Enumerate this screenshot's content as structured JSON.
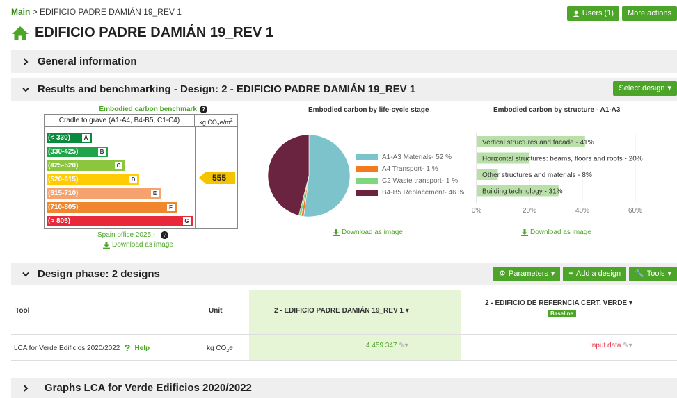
{
  "breadcrumb": {
    "main": "Main",
    "sep": " > ",
    "current": "EDIFICIO PADRE DAMIÁN 19_REV 1"
  },
  "top_actions": {
    "users": "Users (1)",
    "more": "More actions"
  },
  "page_title": "EDIFICIO PADRE DAMIÁN 19_REV 1",
  "sections": {
    "general": "General information",
    "results": "Results and benchmarking - Design: 2 - EDIFICIO PADRE DAMIÁN 19_REV 1",
    "select_design": "Select design",
    "design_phase": "Design phase: 2 designs",
    "graphs": "Graphs LCA for Verde Edificios 2020/2022"
  },
  "benchmark": {
    "title": "Embodied carbon benchmark",
    "col1": "Cradle to grave (A1-A4, B4-B5, C1-C4)",
    "col2_unit": "kg CO",
    "col2_sub": "2",
    "col2_rest": "e/m",
    "col2_sup": "2",
    "score": "555",
    "office": "Spain office 2025 -",
    "download": "Download as image",
    "rows": [
      {
        "range": "(< 330)",
        "letter": "A",
        "color": "#0a8a3c",
        "fill": 0.31
      },
      {
        "range": "(330-425)",
        "letter": "B",
        "color": "#1fa44a",
        "fill": 0.42
      },
      {
        "range": "(425-520)",
        "letter": "C",
        "color": "#8cc63f",
        "fill": 0.535
      },
      {
        "range": "(520-615)",
        "letter": "D",
        "color": "#ffcb05",
        "fill": 0.635
      },
      {
        "range": "(615-710)",
        "letter": "E",
        "color": "#f5a26e",
        "fill": 0.78
      },
      {
        "range": "(710-805)",
        "letter": "F",
        "color": "#f0862e",
        "fill": 0.89
      },
      {
        "range": "(> 805)",
        "letter": "G",
        "color": "#e8293a",
        "fill": 1.0
      }
    ]
  },
  "chart_data": [
    {
      "type": "pie",
      "title": "Embodied carbon by life-cycle stage",
      "slices": [
        {
          "label": "A1-A3 Materials- 52 %",
          "value": 52,
          "color": "#7dc3cc"
        },
        {
          "label": "A4 Transport- 1 %",
          "value": 1,
          "color": "#f47a1f"
        },
        {
          "label": "C2 Waste transport- 1 %",
          "value": 1,
          "color": "#7fd67f"
        },
        {
          "label": "B4-B5 Replacement- 46 %",
          "value": 46,
          "color": "#6b2440"
        }
      ],
      "download": "Download as image"
    },
    {
      "type": "bar",
      "orientation": "horizontal",
      "title": "Embodied carbon by structure - A1-A3",
      "categories": [
        "Vertical structures and facade",
        "Horizontal structures: beams, floors and roofs",
        "Other structures and materials",
        "Building technology"
      ],
      "labels": [
        "Vertical structures and facade - 41%",
        "Horizontal structures: beams, floors and roofs - 20%",
        "Other structures and materials - 8%",
        "Building technology - 31%"
      ],
      "values": [
        41,
        20,
        8,
        31
      ],
      "xlim": [
        0,
        60
      ],
      "ticks": [
        "0%",
        "20%",
        "40%",
        "60%"
      ],
      "tick_values": [
        0,
        20,
        40,
        60
      ],
      "grid": true,
      "color": "#b9e0a8",
      "download": "Download as image"
    }
  ],
  "design_actions": {
    "parameters": "Parameters",
    "add": "Add a design",
    "tools": "Tools"
  },
  "design_table": {
    "col_tool": "Tool",
    "col_unit": "Unit",
    "design1": "2 - EDIFICIO PADRE DAMIÁN 19_REV 1",
    "design2": "2 - EDIFICIO DE REFERNCIA CERT. VERDE",
    "baseline": "Baseline",
    "row": {
      "tool": "LCA for Verde Edificios 2020/2022",
      "help": "Help",
      "unit_main": "kg CO",
      "unit_sub": "2",
      "unit_end": "e",
      "value1": "4 459 347",
      "value2": "Input data"
    }
  }
}
